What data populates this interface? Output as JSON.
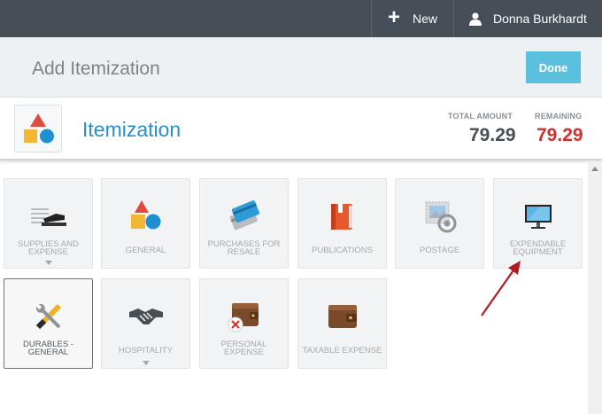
{
  "topbar": {
    "new_label": "New",
    "user_name": "Donna Burkhardt"
  },
  "header": {
    "title": "Add Itemization",
    "done_label": "Done"
  },
  "itemization": {
    "title": "Itemization",
    "total_label": "TOTAL AMOUNT",
    "total_value": "79.29",
    "remaining_label": "REMAINING",
    "remaining_value": "79.29"
  },
  "colors": {
    "accent": "#2a8fc8",
    "done_button": "#5bc0de",
    "remaining": "#d0312d",
    "topbar": "#464e57"
  },
  "tiles": [
    {
      "label": "SUPPLIES AND EXPENSE",
      "icon": "stapler-icon",
      "has_caret": true
    },
    {
      "label": "GENERAL",
      "icon": "shapes-icon",
      "has_caret": false
    },
    {
      "label": "PURCHASES FOR RESALE",
      "icon": "credit-cards-icon",
      "has_caret": false
    },
    {
      "label": "PUBLICATIONS",
      "icon": "book-icon",
      "has_caret": false
    },
    {
      "label": "POSTAGE",
      "icon": "stamp-icon",
      "has_caret": false
    },
    {
      "label": "EXPENDABLE EQUIPMENT",
      "icon": "monitor-icon",
      "has_caret": false
    },
    {
      "label": "DURABLES - GENERAL",
      "icon": "tools-icon",
      "has_caret": false,
      "selected": true
    },
    {
      "label": "HOSPITALITY",
      "icon": "handshake-icon",
      "has_caret": true
    },
    {
      "label": "PERSONAL EXPENSE",
      "icon": "wallet-excluded-icon",
      "has_caret": false
    },
    {
      "label": "TAXABLE EXPENSE",
      "icon": "wallet-icon",
      "has_caret": false
    }
  ]
}
